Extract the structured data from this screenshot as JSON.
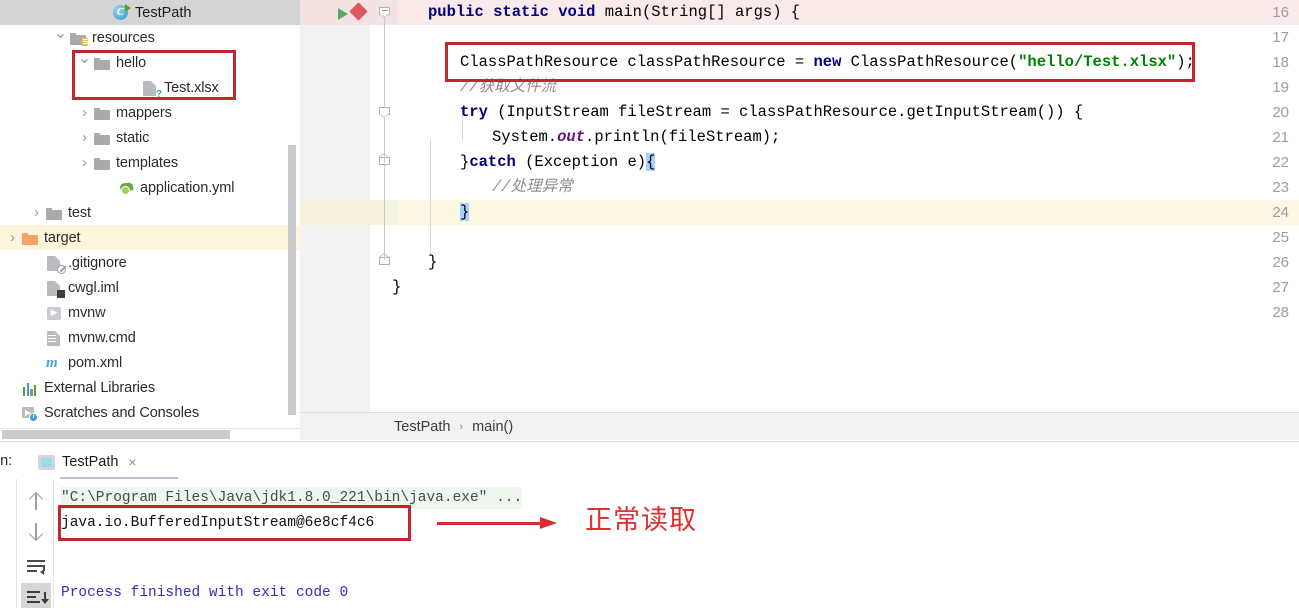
{
  "editor_tab": {
    "label": "TestPath",
    "icon": "java-class-icon"
  },
  "project_tree": [
    {
      "label": "resources",
      "indent": 2,
      "chevron": "down",
      "icon": "resources-folder-icon"
    },
    {
      "label": "hello",
      "indent": 3,
      "chevron": "down",
      "icon": "folder-icon"
    },
    {
      "label": "Test.xlsx",
      "indent": 5,
      "chevron": "none",
      "icon": "unknown-file-icon"
    },
    {
      "label": "mappers",
      "indent": 3,
      "chevron": "right",
      "icon": "folder-icon"
    },
    {
      "label": "static",
      "indent": 3,
      "chevron": "right",
      "icon": "folder-icon"
    },
    {
      "label": "templates",
      "indent": 3,
      "chevron": "right",
      "icon": "folder-icon"
    },
    {
      "label": "application.yml",
      "indent": 4,
      "chevron": "none",
      "icon": "yml-file-icon"
    },
    {
      "label": "test",
      "indent": 1,
      "chevron": "right",
      "icon": "folder-icon"
    },
    {
      "label": "target",
      "indent": 0,
      "chevron": "right",
      "icon": "target-folder-icon",
      "selected": true
    },
    {
      "label": ".gitignore",
      "indent": 1,
      "chevron": "none",
      "icon": "gitignore-file-icon"
    },
    {
      "label": "cwgl.iml",
      "indent": 1,
      "chevron": "none",
      "icon": "iml-file-icon"
    },
    {
      "label": "mvnw",
      "indent": 1,
      "chevron": "none",
      "icon": "script-file-icon"
    },
    {
      "label": "mvnw.cmd",
      "indent": 1,
      "chevron": "none",
      "icon": "cmd-file-icon"
    },
    {
      "label": "pom.xml",
      "indent": 1,
      "chevron": "none",
      "icon": "maven-file-icon"
    },
    {
      "label": "External Libraries",
      "indent": 0,
      "chevron": "none",
      "icon": "libraries-icon"
    },
    {
      "label": "Scratches and Consoles",
      "indent": 0,
      "chevron": "none",
      "icon": "scratches-icon"
    }
  ],
  "code": {
    "first_line_number": 16,
    "lines": [
      {
        "n": 16,
        "text": "public static void main(String[] args) {"
      },
      {
        "n": 17,
        "text": ""
      },
      {
        "n": 18,
        "text": "    ClassPathResource classPathResource = new ClassPathResource(\"hello/Test.xlsx\");"
      },
      {
        "n": 19,
        "text": "    //获取文件流"
      },
      {
        "n": 20,
        "text": "    try (InputStream fileStream = classPathResource.getInputStream()) {"
      },
      {
        "n": 21,
        "text": "        System.out.println(fileStream);"
      },
      {
        "n": 22,
        "text": "    }catch (Exception e){"
      },
      {
        "n": 23,
        "text": "        //处理异常"
      },
      {
        "n": 24,
        "text": "    }"
      },
      {
        "n": 25,
        "text": ""
      },
      {
        "n": 26,
        "text": "  }"
      },
      {
        "n": 27,
        "text": "}"
      },
      {
        "n": 28,
        "text": ""
      }
    ],
    "keywords": [
      "public",
      "static",
      "void",
      "new",
      "try",
      "catch"
    ],
    "string_literal": "\"hello/Test.xlsx\"",
    "comments": [
      "//获取文件流",
      "//处理异常"
    ],
    "caret_line": 24
  },
  "breadcrumb": {
    "class": "TestPath",
    "separator": "›",
    "method": "main()"
  },
  "run_panel": {
    "label": "un:",
    "tab": "TestPath",
    "close": "×",
    "toolbar": [
      "up-arrow-icon",
      "down-arrow-icon",
      "soft-wrap-icon",
      "scroll-to-end-icon"
    ],
    "console": [
      {
        "text": "\"C:\\Program Files\\Java\\jdk1.8.0_221\\bin\\java.exe\" ...",
        "style": "command"
      },
      {
        "text": "java.io.BufferedInputStream@6e8cf4c6",
        "style": "output"
      },
      {
        "text": "Process finished with exit code 0",
        "style": "status"
      }
    ]
  },
  "annotation": {
    "text": "正常读取",
    "arrow": "right-arrow",
    "color": "#e03030"
  },
  "colors": {
    "highlight_box": "#c0282d",
    "keyword": "#000080",
    "string": "#008000",
    "comment": "#8c8c8c",
    "field": "#660e7a",
    "caret_line": "#fcf8e4",
    "selected_row": "#fdf6dd",
    "error_row": "#faeaea"
  }
}
